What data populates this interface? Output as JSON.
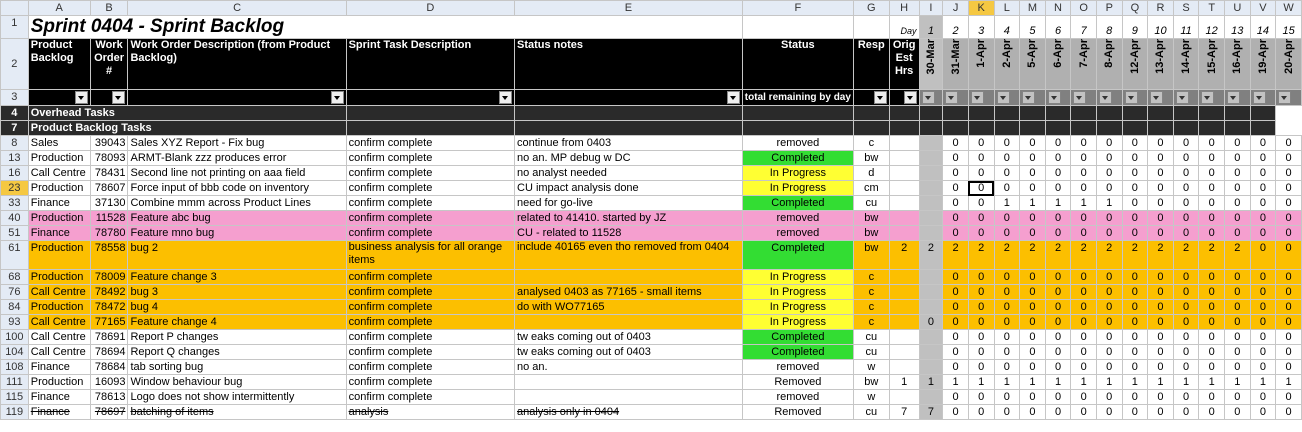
{
  "title": "Sprint 0404 - Sprint Backlog",
  "columns": [
    "A",
    "B",
    "C",
    "D",
    "E",
    "F",
    "G",
    "H",
    "I",
    "J",
    "K",
    "L",
    "M",
    "N",
    "O",
    "P",
    "Q",
    "R",
    "S",
    "T",
    "U",
    "V",
    "W"
  ],
  "day_label": "Day",
  "days": [
    "",
    "1",
    "2",
    "3",
    "4",
    "5",
    "6",
    "7",
    "8",
    "9",
    "10",
    "11",
    "12",
    "13",
    "14",
    "15"
  ],
  "dates": [
    "30-Mar",
    "31-Mar",
    "1-Apr",
    "2-Apr",
    "5-Apr",
    "6-Apr",
    "7-Apr",
    "8-Apr",
    "12-Apr",
    "13-Apr",
    "14-Apr",
    "15-Apr",
    "16-Apr",
    "19-Apr",
    "20-Apr"
  ],
  "headers": {
    "product_backlog": "Product Backlog",
    "work_order": "Work Order #",
    "wo_desc": "Work Order Description (from Product Backlog)",
    "task_desc": "Sprint Task Description",
    "status_notes": "Status notes",
    "status": "Status",
    "resp": "Resp",
    "orig_est": "Orig Est Hrs",
    "total_remaining": "total remaining by day"
  },
  "sections": {
    "overhead": "Overhead Tasks",
    "product_backlog": "Product Backlog Tasks"
  },
  "row_numbers": [
    "1",
    "2",
    "3",
    "4",
    "7"
  ],
  "rows": [
    {
      "n": "8",
      "a": "Sales",
      "b": "39043",
      "c": "Sales XYZ Report - Fix bug",
      "d": "confirm complete",
      "e": "continue from 0403",
      "f": "removed",
      "fs": "removed",
      "g": "c",
      "h": "",
      "i": "",
      "days": [
        "0",
        "0",
        "0",
        "0",
        "0",
        "0",
        "0",
        "0",
        "0",
        "0",
        "0",
        "0",
        "0",
        "0"
      ],
      "bg": ""
    },
    {
      "n": "13",
      "a": "Production",
      "b": "78093",
      "c": "ARMT-Blank zzz produces error",
      "d": "confirm complete",
      "e": "no an. MP debug w DC",
      "f": "Completed",
      "fs": "completed",
      "g": "bw",
      "h": "",
      "i": "",
      "days": [
        "0",
        "0",
        "0",
        "0",
        "0",
        "0",
        "0",
        "0",
        "0",
        "0",
        "0",
        "0",
        "0",
        "0"
      ],
      "bg": ""
    },
    {
      "n": "16",
      "a": "Call Centre",
      "b": "78431",
      "c": "Second line not printing on aaa field",
      "d": "confirm complete",
      "e": "no analyst needed",
      "f": "In Progress",
      "fs": "progress",
      "g": "d",
      "h": "",
      "i": "",
      "days": [
        "0",
        "0",
        "0",
        "0",
        "0",
        "0",
        "0",
        "0",
        "0",
        "0",
        "0",
        "0",
        "0",
        "0"
      ],
      "bg": ""
    },
    {
      "n": "23",
      "a": "Production",
      "b": "78607",
      "c": "Force input of bbb code on inventory",
      "d": "confirm complete",
      "e": "CU impact analysis done",
      "f": "In Progress",
      "fs": "progress",
      "g": "cm",
      "h": "",
      "i": "",
      "days": [
        "0",
        "0",
        "0",
        "0",
        "0",
        "0",
        "0",
        "0",
        "0",
        "0",
        "0",
        "0",
        "0",
        "0"
      ],
      "bg": ""
    },
    {
      "n": "33",
      "a": "Finance",
      "b": "37130",
      "c": "Combine mmm across Product Lines",
      "d": "confirm complete",
      "e": "need for go-live",
      "f": "Completed",
      "fs": "completed",
      "g": "cu",
      "h": "",
      "i": "",
      "days": [
        "0",
        "0",
        "1",
        "1",
        "1",
        "1",
        "1",
        "0",
        "0",
        "0",
        "0",
        "0",
        "0",
        "0"
      ],
      "bg": ""
    },
    {
      "n": "40",
      "a": "Production",
      "b": "11528",
      "c": "Feature abc bug",
      "d": "confirm complete",
      "e": "related to 41410. started by JZ",
      "f": "removed",
      "fs": "removed",
      "g": "bw",
      "h": "",
      "i": "",
      "days": [
        "0",
        "0",
        "0",
        "0",
        "0",
        "0",
        "0",
        "0",
        "0",
        "0",
        "0",
        "0",
        "0",
        "0"
      ],
      "bg": "pink"
    },
    {
      "n": "51",
      "a": "Finance",
      "b": "78780",
      "c": "Feature mno bug",
      "d": "confirm complete",
      "e": "CU - related to 11528",
      "f": "removed",
      "fs": "removed",
      "g": "bw",
      "h": "",
      "i": "",
      "days": [
        "0",
        "0",
        "0",
        "0",
        "0",
        "0",
        "0",
        "0",
        "0",
        "0",
        "0",
        "0",
        "0",
        "0"
      ],
      "bg": "pink"
    },
    {
      "n": "61",
      "a": "Production",
      "b": "78558",
      "c": "bug 2",
      "d": "business analysis for all orange items",
      "e": "include 40165 even tho removed from 0404",
      "f": "Completed",
      "fs": "completed",
      "g": "bw",
      "h": "2",
      "i": "2",
      "days": [
        "2",
        "2",
        "2",
        "2",
        "2",
        "2",
        "2",
        "2",
        "2",
        "2",
        "2",
        "2",
        "0",
        "0"
      ],
      "bg": "orange",
      "tall": true
    },
    {
      "n": "68",
      "a": "Production",
      "b": "78009",
      "c": "Feature change 3",
      "d": "confirm complete",
      "e": "",
      "f": "In Progress",
      "fs": "progress",
      "g": "c",
      "h": "",
      "i": "",
      "days": [
        "0",
        "0",
        "0",
        "0",
        "0",
        "0",
        "0",
        "0",
        "0",
        "0",
        "0",
        "0",
        "0",
        "0"
      ],
      "bg": "orange"
    },
    {
      "n": "76",
      "a": "Call Centre",
      "b": "78492",
      "c": "bug 3",
      "d": "confirm complete",
      "e": "analysed 0403 as 77165 - small items",
      "f": "In Progress",
      "fs": "progress",
      "g": "c",
      "h": "",
      "i": "",
      "days": [
        "0",
        "0",
        "0",
        "0",
        "0",
        "0",
        "0",
        "0",
        "0",
        "0",
        "0",
        "0",
        "0",
        "0"
      ],
      "bg": "orange"
    },
    {
      "n": "84",
      "a": "Production",
      "b": "78472",
      "c": "bug 4",
      "d": "confirm complete",
      "e": "do with WO77165",
      "f": "In Progress",
      "fs": "progress",
      "g": "c",
      "h": "",
      "i": "",
      "days": [
        "0",
        "0",
        "0",
        "0",
        "0",
        "0",
        "0",
        "0",
        "0",
        "0",
        "0",
        "0",
        "0",
        "0"
      ],
      "bg": "orange"
    },
    {
      "n": "93",
      "a": "Call Centre",
      "b": "77165",
      "c": "Feature change 4",
      "d": "confirm complete",
      "e": "",
      "f": "In Progress",
      "fs": "progress",
      "g": "c",
      "h": "",
      "i": "0",
      "days": [
        "0",
        "0",
        "0",
        "0",
        "0",
        "0",
        "0",
        "0",
        "0",
        "0",
        "0",
        "0",
        "0",
        "0"
      ],
      "bg": "orange"
    },
    {
      "n": "100",
      "a": "Call Centre",
      "b": "78691",
      "c": "Report P changes",
      "d": "confirm complete",
      "e": "tw eaks coming out of 0403",
      "f": "Completed",
      "fs": "completed",
      "g": "cu",
      "h": "",
      "i": "",
      "days": [
        "0",
        "0",
        "0",
        "0",
        "0",
        "0",
        "0",
        "0",
        "0",
        "0",
        "0",
        "0",
        "0",
        "0"
      ],
      "bg": ""
    },
    {
      "n": "104",
      "a": "Call Centre",
      "b": "78694",
      "c": "Report Q changes",
      "d": "confirm complete",
      "e": "tw eaks coming out of 0403",
      "f": "Completed",
      "fs": "completed",
      "g": "cu",
      "h": "",
      "i": "",
      "days": [
        "0",
        "0",
        "0",
        "0",
        "0",
        "0",
        "0",
        "0",
        "0",
        "0",
        "0",
        "0",
        "0",
        "0"
      ],
      "bg": ""
    },
    {
      "n": "108",
      "a": "Finance",
      "b": "78684",
      "c": "tab sorting bug",
      "d": "confirm complete",
      "e": "no an.",
      "f": "removed",
      "fs": "removed",
      "g": "w",
      "h": "",
      "i": "",
      "days": [
        "0",
        "0",
        "0",
        "0",
        "0",
        "0",
        "0",
        "0",
        "0",
        "0",
        "0",
        "0",
        "0",
        "0"
      ],
      "bg": ""
    },
    {
      "n": "111",
      "a": "Production",
      "b": "16093",
      "c": "Window  behaviour bug",
      "d": "confirm complete",
      "e": "",
      "f": "Removed",
      "fs": "removed",
      "g": "bw",
      "h": "1",
      "i": "1",
      "days": [
        "1",
        "1",
        "1",
        "1",
        "1",
        "1",
        "1",
        "1",
        "1",
        "1",
        "1",
        "1",
        "1",
        "1"
      ],
      "bg": ""
    },
    {
      "n": "115",
      "a": "Finance",
      "b": "78613",
      "c": "Logo does not show intermittently",
      "d": "confirm complete",
      "e": "",
      "f": "removed",
      "fs": "removed",
      "g": "w",
      "h": "",
      "i": "",
      "days": [
        "0",
        "0",
        "0",
        "0",
        "0",
        "0",
        "0",
        "0",
        "0",
        "0",
        "0",
        "0",
        "0",
        "0"
      ],
      "bg": ""
    },
    {
      "n": "119",
      "a": "Finance",
      "b": "78697",
      "c": "batching of items",
      "d": "analysis",
      "e": "analysis only in 0404",
      "f": "Removed",
      "fs": "removed",
      "g": "cu",
      "h": "7",
      "i": "7",
      "days": [
        "0",
        "0",
        "0",
        "0",
        "0",
        "0",
        "0",
        "0",
        "0",
        "0",
        "0",
        "0",
        "0",
        "0"
      ],
      "bg": "",
      "strike": true
    }
  ]
}
